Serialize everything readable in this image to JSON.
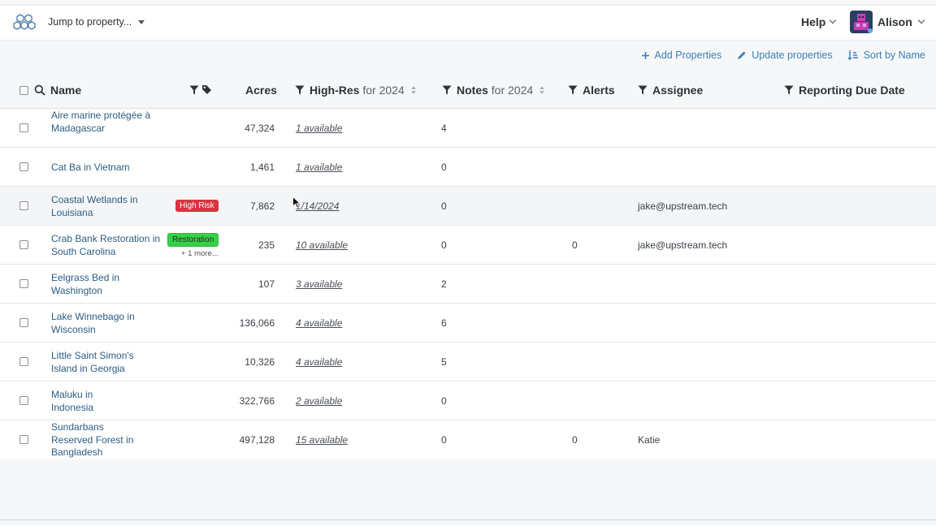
{
  "header": {
    "jump_label": "Jump to property...",
    "help_label": "Help",
    "user_name": "Alison"
  },
  "actions": {
    "add_label": "Add Properties",
    "update_label": "Update properties",
    "sort_label": "Sort by Name"
  },
  "columns": {
    "name": "Name",
    "acres": "Acres",
    "hires_a": "High-Res",
    "hires_b": "for 2024",
    "notes_a": "Notes",
    "notes_b": "for 2024",
    "alerts": "Alerts",
    "assignee": "Assignee",
    "due": "Reporting Due Date"
  },
  "rows": [
    {
      "name": "Aire marine protégée à Madagascar",
      "acres": "47,324",
      "hires": "1 available",
      "notes": "4",
      "alerts": "",
      "assignee": "",
      "tag": "",
      "more": ""
    },
    {
      "name": "Cat Ba in Vietnam",
      "acres": "1,461",
      "hires": "1 available",
      "notes": "0",
      "alerts": "",
      "assignee": "",
      "tag": "",
      "more": ""
    },
    {
      "name": "Coastal Wetlands in Louisiana",
      "acres": "7,862",
      "hires": "1/14/2024",
      "notes": "0",
      "alerts": "",
      "assignee": "jake@upstream.tech",
      "tag": "High Risk",
      "more": ""
    },
    {
      "name": "Crab Bank Restoration in South Carolina",
      "acres": "235",
      "hires": "10 available",
      "notes": "0",
      "alerts": "0",
      "assignee": "jake@upstream.tech",
      "tag": "Restoration",
      "more": "+ 1 more..."
    },
    {
      "name": "Eelgrass Bed in Washington",
      "acres": "107",
      "hires": "3 available",
      "notes": "2",
      "alerts": "",
      "assignee": "",
      "tag": "",
      "more": ""
    },
    {
      "name": "Lake Winnebago in Wisconsin",
      "acres": "136,066",
      "hires": "4 available",
      "notes": "6",
      "alerts": "",
      "assignee": "",
      "tag": "",
      "more": ""
    },
    {
      "name": "Little Saint Simon's Island in Georgia",
      "acres": "10,326",
      "hires": "4 available",
      "notes": "5",
      "alerts": "",
      "assignee": "",
      "tag": "",
      "more": ""
    },
    {
      "name": "Maluku in Indonesia",
      "acres": "322,766",
      "hires": "2 available",
      "notes": "0",
      "alerts": "",
      "assignee": "",
      "tag": "",
      "more": ""
    },
    {
      "name": "Sundarbans Reserved Forest in Bangladesh",
      "acres": "497,128",
      "hires": "15 available",
      "notes": "0",
      "alerts": "0",
      "assignee": "Katie",
      "tag": "",
      "more": ""
    }
  ],
  "colors": {
    "link": "#2c5d82",
    "action": "#3a7fb8",
    "tag_red": "#d9333f",
    "tag_green": "#38d04a"
  }
}
